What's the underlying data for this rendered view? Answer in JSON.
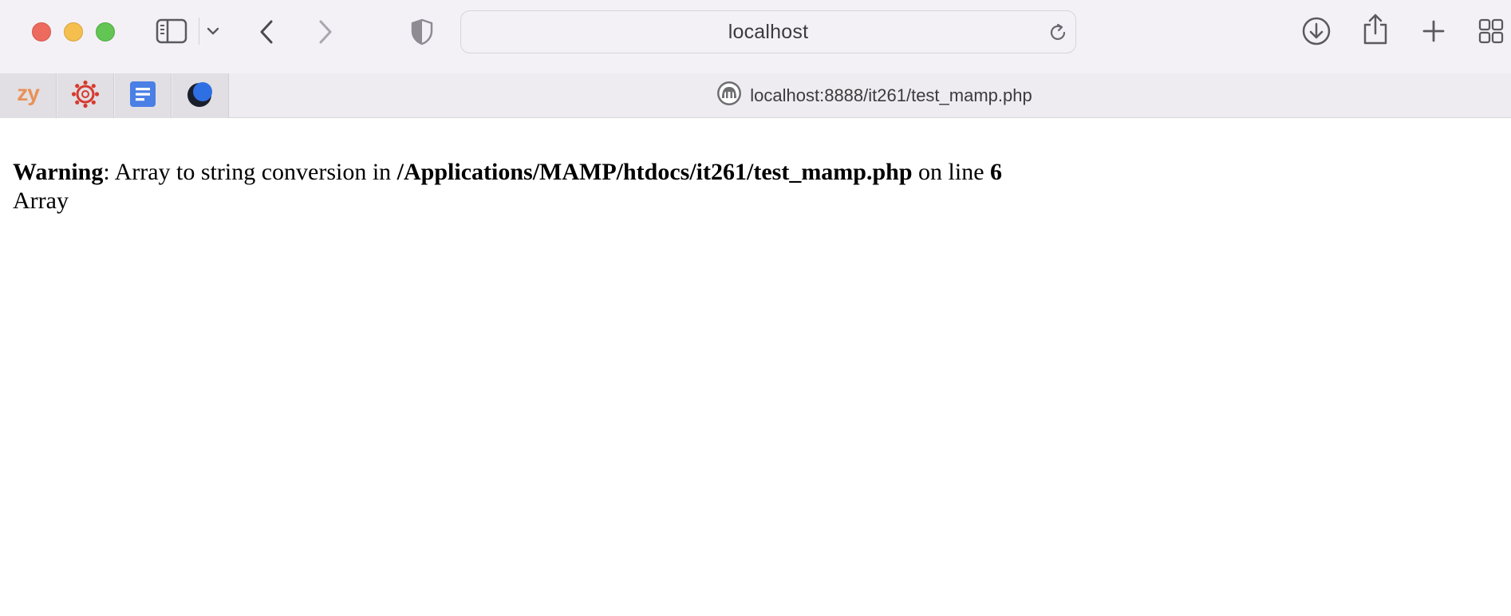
{
  "browser": {
    "address_bar": {
      "text": "localhost"
    },
    "favorites": [
      {
        "name": "zybooks",
        "label": "zy",
        "icon": "zybooks-logo"
      },
      {
        "name": "canvas",
        "icon": "canvas-logo"
      },
      {
        "name": "google-docs",
        "icon": "google-docs-logo"
      },
      {
        "name": "moon-app",
        "icon": "moon-logo"
      }
    ],
    "active_tab": {
      "title": "localhost:8888/it261/test_mamp.php",
      "icon": "mamp-elephant-icon"
    },
    "toolbar_icons": [
      "sidebar-icon",
      "chevron-down-icon",
      "back-icon",
      "forward-icon",
      "privacy-shield-icon",
      "reload-icon",
      "downloads-icon",
      "share-icon",
      "new-tab-icon",
      "tab-overview-icon"
    ]
  },
  "page": {
    "warning_label": "Warning",
    "warning_sep": ": ",
    "warning_message": "Array to string conversion in ",
    "file_path": "/Applications/MAMP/htdocs/it261/test_mamp.php",
    "on_line_text": " on line ",
    "line_number": "6",
    "output": "Array"
  },
  "colors": {
    "toolbar_bg": "#f3f1f6",
    "close": "#ed6a5e",
    "minimize": "#f5bf4f",
    "maximize": "#62c554",
    "zybooks_orange": "#e8915a",
    "canvas_red": "#d63a2f",
    "docs_blue": "#4a7fe5"
  }
}
